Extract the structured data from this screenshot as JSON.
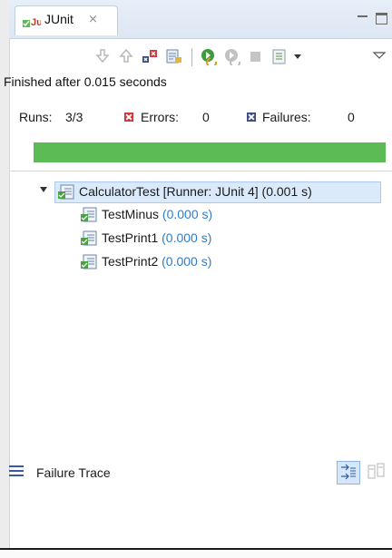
{
  "tab": {
    "title": "JUnit",
    "close": "⨯"
  },
  "toolbar": {
    "icons": [
      "next-failure-icon",
      "previous-failure-icon",
      "failures-only-icon",
      "scroll-lock-icon",
      "rerun-icon",
      "rerun-failed-first-icon",
      "stop-icon",
      "history-icon",
      "dropdown-icon",
      "view-menu-icon"
    ]
  },
  "status": "Finished after 0.015 seconds",
  "counters": {
    "runs_label": "Runs:",
    "runs_value": "3/3",
    "errors_label": "Errors:",
    "errors_value": "0",
    "failures_label": "Failures:",
    "failures_value": "0"
  },
  "progress": {
    "fraction": 1.0,
    "color": "#5cbb55"
  },
  "tree": {
    "root": {
      "name": "CalculatorTest [Runner: JUnit 4]",
      "time": "(0.001 s)"
    },
    "children": [
      {
        "name": "TestMinus",
        "time": "(0.000 s)"
      },
      {
        "name": "TestPrint1",
        "time": "(0.000 s)"
      },
      {
        "name": "TestPrint2",
        "time": "(0.000 s)"
      }
    ]
  },
  "trace": {
    "label": "Failure Trace"
  },
  "colors": {
    "success": "#5cbb55",
    "error": "#d1343a",
    "failure": "#3c4c86",
    "time_text": "#2d7cc9"
  }
}
